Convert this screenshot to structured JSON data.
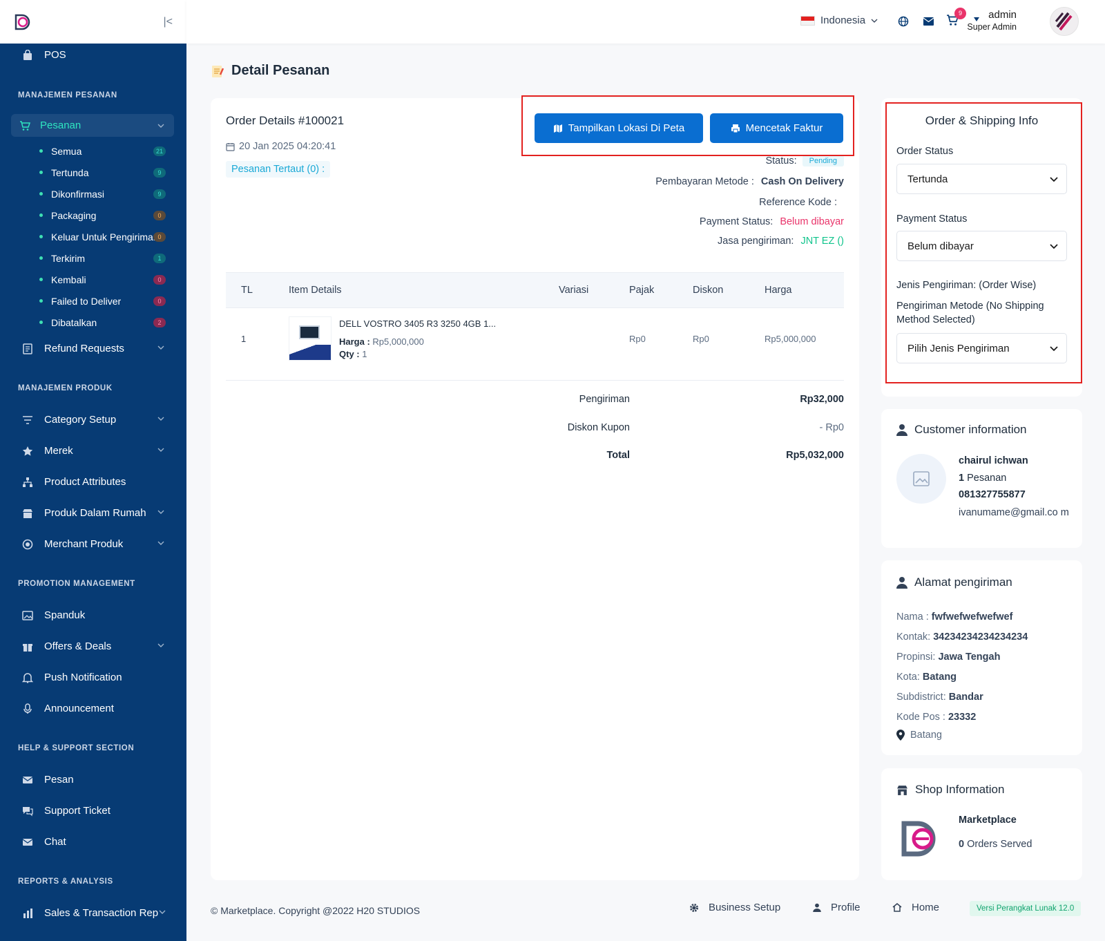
{
  "sidebar": {
    "pos": "POS",
    "sec_orders": "MANAJEMEN PESANAN",
    "orders_label": "Pesanan",
    "sub": [
      {
        "label": "Semua",
        "count": "21",
        "tone": "teal"
      },
      {
        "label": "Tertunda",
        "count": "9",
        "tone": "teal"
      },
      {
        "label": "Dikonfirmasi",
        "count": "9",
        "tone": "teal"
      },
      {
        "label": "Packaging",
        "count": "0",
        "tone": "orange"
      },
      {
        "label": "Keluar Untuk Pengiriman",
        "count": "0",
        "tone": "orange"
      },
      {
        "label": "Terkirim",
        "count": "1",
        "tone": "teal"
      },
      {
        "label": "Kembali",
        "count": "0",
        "tone": "pink"
      },
      {
        "label": "Failed to Deliver",
        "count": "0",
        "tone": "pink"
      },
      {
        "label": "Dibatalkan",
        "count": "2",
        "tone": "pink"
      }
    ],
    "refund": "Refund Requests",
    "sec_products": "MANAJEMEN PRODUK",
    "category": "Category Setup",
    "brand": "Merek",
    "attributes": "Product Attributes",
    "inhouse": "Produk Dalam Rumah",
    "merchant": "Merchant Produk",
    "sec_promo": "PROMOTION MANAGEMENT",
    "banner": "Spanduk",
    "offers": "Offers & Deals",
    "push": "Push Notification",
    "announce": "Announcement",
    "sec_help": "HELP & SUPPORT SECTION",
    "messages": "Pesan",
    "ticket": "Support Ticket",
    "chat": "Chat",
    "sec_reports": "REPORTS & ANALYSIS",
    "sales": "Sales & Transaction Rep"
  },
  "topbar": {
    "language": "Indonesia",
    "cart_count": "9",
    "user_name": "admin",
    "user_role": "Super Admin"
  },
  "page": {
    "title": "Detail Pesanan"
  },
  "order": {
    "title": "Order Details #100021",
    "date": "20 Jan 2025 04:20:41",
    "linked": "Pesanan Tertaut (0) :",
    "btn_map": "Tampilkan Lokasi Di Peta",
    "btn_print": "Mencetak Faktur",
    "status_label": "Status:",
    "status_value": "Pending",
    "pay_method_label": "Pembayaran Metode :",
    "pay_method_value": "Cash On Delivery",
    "ref_label": "Reference Kode :",
    "pay_status_label": "Payment Status:",
    "pay_status_value": "Belum dibayar",
    "courier_label": "Jasa pengiriman:",
    "courier_value": "JNT EZ ()"
  },
  "table": {
    "headers": [
      "TL",
      "Item Details",
      "Variasi",
      "Pajak",
      "Diskon",
      "Harga"
    ],
    "row": {
      "no": "1",
      "name": "DELL VOSTRO 3405 R3 3250 4GB 1...",
      "price_label": "Harga :",
      "price": "Rp5,000,000",
      "qty_label": "Qty :",
      "qty": "1",
      "tax": "Rp0",
      "discount": "Rp0",
      "total": "Rp5,000,000"
    }
  },
  "summary": {
    "shipping_label": "Pengiriman",
    "shipping_value": "Rp32,000",
    "coupon_label": "Diskon Kupon",
    "coupon_value": "- Rp0",
    "total_label": "Total",
    "total_value": "Rp5,032,000"
  },
  "shipping_info": {
    "title": "Order & Shipping Info",
    "order_status_label": "Order Status",
    "order_status_value": "Tertunda",
    "payment_status_label": "Payment Status",
    "payment_status_value": "Belum dibayar",
    "ship_type_label": "Jenis Pengiriman: (Order Wise)",
    "ship_method_label": "Pengiriman Metode (No Shipping Method Selected)",
    "ship_select_value": "Pilih Jenis Pengiriman"
  },
  "customer": {
    "title": "Customer information",
    "name": "chairul ichwan",
    "orders_count": "1",
    "orders_word": "Pesanan",
    "phone": "081327755877",
    "email": "ivanumame@gmail.co m"
  },
  "address": {
    "title": "Alamat pengiriman",
    "name_label": "Nama :",
    "name_value": "fwfwefwefwefwef",
    "contact_label": "Kontak:",
    "contact_value": "34234234234234234",
    "province_label": "Propinsi:",
    "province_value": "Jawa Tengah",
    "city_label": "Kota:",
    "city_value": "Batang",
    "subdistrict_label": "Subdistrict:",
    "subdistrict_value": "Bandar",
    "zip_label": "Kode Pos :",
    "zip_value": "23332",
    "location": "Batang"
  },
  "shop": {
    "title": "Shop Information",
    "name": "Marketplace",
    "served_count": "0",
    "served_word": "Orders Served"
  },
  "footer": {
    "copyright": "© Marketplace. Copyright @2022 H20 STUDIOS",
    "business": "Business Setup",
    "profile": "Profile",
    "home": "Home",
    "version": "Versi Perangkat Lunak 12.0"
  },
  "colors": {
    "sidebar": "#073b74",
    "primary": "#0a6ed1",
    "accent": "#2ee5c0",
    "danger": "#e9346a",
    "success": "#10c48c",
    "highlight": "#e3211f"
  }
}
